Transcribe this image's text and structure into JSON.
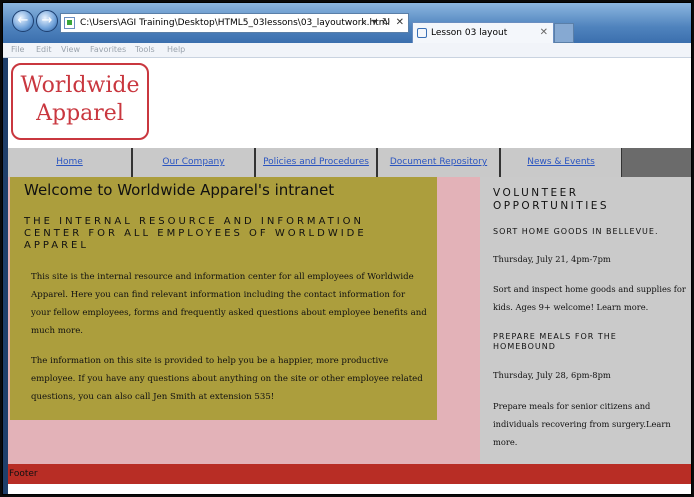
{
  "browser": {
    "address": "C:\\Users\\AGI Training\\Desktop\\HTML5_03lessons\\03_layoutwork.html",
    "address_controls": "⌕ ▾ ↻ ✕",
    "tab_title": "Lesson 03 layout",
    "menu": [
      "File",
      "Edit",
      "View",
      "Favorites",
      "Tools",
      "Help"
    ]
  },
  "logo": {
    "line1": "Worldwide",
    "line2": "Apparel"
  },
  "nav": [
    "Home",
    "Our Company",
    "Policies and Procedures",
    "Document Repository",
    "News & Events"
  ],
  "main": {
    "heading": "Welcome to Worldwide Apparel's intranet",
    "subheading": "The internal resource and information center for all employees of Worldwide Apparel",
    "para1": "This site is the internal resource and information center for all employees of Worldwide Apparel. Here you can find relevant information including the contact information for your fellow employees, forms and frequently asked questions about employee benefits and much more.",
    "para2": "The information on this site is provided to help you be a happier, more productive employee. If you have any questions about anything on the site or other employee related questions, you can also call Jen Smith at extension 535!"
  },
  "sidebar": {
    "title": "VOLUNTEER OPPORTUNITIES",
    "event1": {
      "title": "SORT HOME GOODS IN BELLEVUE.",
      "date": "Thursday, July 21, 4pm-7pm",
      "desc": "Sort and inspect home goods and supplies for kids. Ages 9+ welcome! Learn more."
    },
    "event2": {
      "title": "PREPARE MEALS FOR THE HOMEBOUND",
      "date": "Thursday, July 28, 6pm-8pm",
      "desc": "Prepare meals for senior citizens and individuals recovering from surgery.Learn more."
    }
  },
  "footer": "Footer",
  "colors": {
    "logo_red": "#c9373f",
    "main_olive": "#ac9e3d",
    "pink": "#e3b2b8",
    "sidebar_gray": "#cacaca",
    "footer_red": "#b82d25",
    "nav_link": "#2b55c0"
  }
}
